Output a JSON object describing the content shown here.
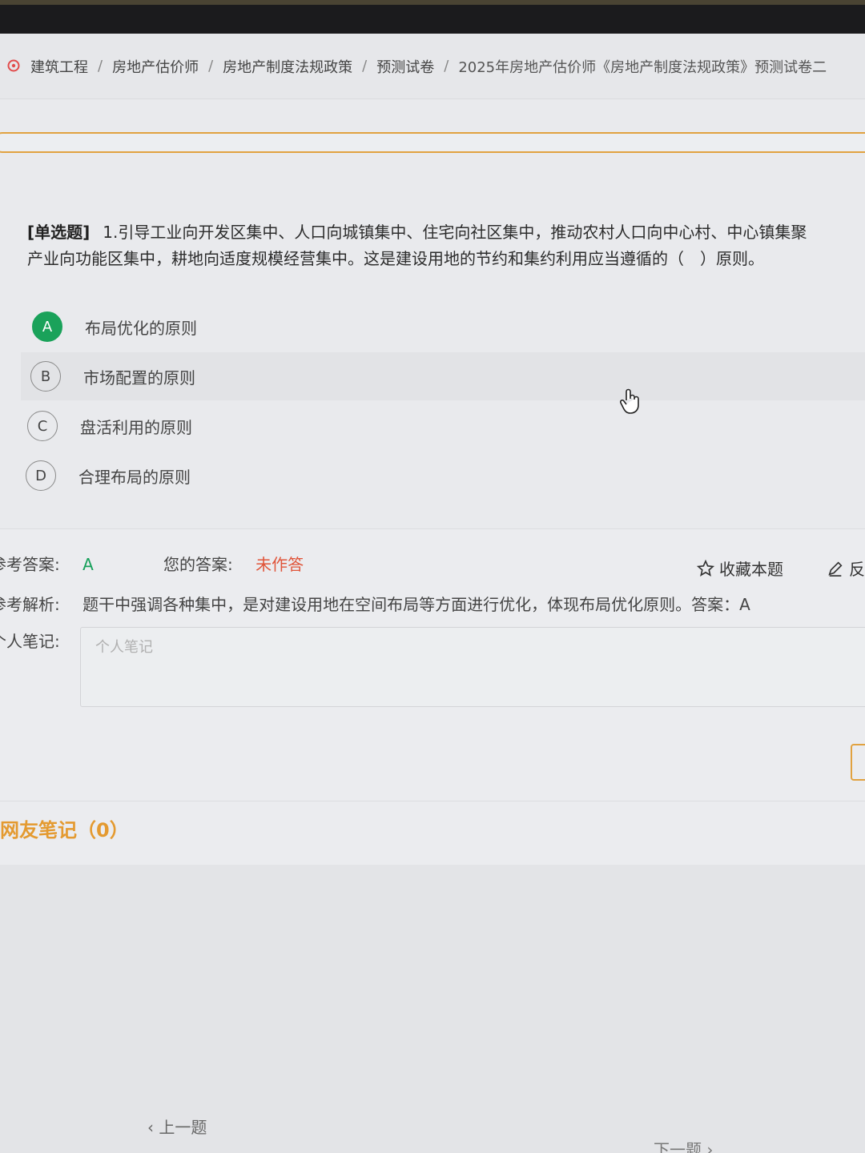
{
  "breadcrumb": {
    "items": [
      "建筑工程",
      "房地产估价师",
      "房地产制度法规政策",
      "预测试卷",
      "2025年房地产估价师《房地产制度法规政策》预测试卷二"
    ],
    "separator": "/"
  },
  "question": {
    "type_label": "[单选题]",
    "text": "1.引导工业向开发区集中、人口向城镇集中、住宅向社区集中，推动农村人口向中心村、中心镇集聚",
    "text_line2": "产业向功能区集中，耕地向适度规模经营集中。这是建设用地的节约和集约利用应当遵循的（　）原则。",
    "options": [
      {
        "letter": "A",
        "text": "布局优化的原则",
        "correct": true
      },
      {
        "letter": "B",
        "text": "市场配置的原则",
        "correct": false
      },
      {
        "letter": "C",
        "text": "盘活利用的原则",
        "correct": false
      },
      {
        "letter": "D",
        "text": "合理布局的原则",
        "correct": false
      }
    ]
  },
  "answer": {
    "ref_label": "参考答案:",
    "ref_value": "A",
    "your_label": "您的答案:",
    "your_value": "未作答",
    "favorite_label": "收藏本题",
    "feedback_label": "反",
    "analysis_label": "参考解析:",
    "analysis_text": "题干中强调各种集中，是对建设用地在空间布局等方面进行优化，体现布局优化原则。答案：A",
    "note_label": "个人笔记:",
    "note_placeholder": "个人笔记"
  },
  "friends_notes": {
    "title": "网友笔记（0）"
  },
  "nav": {
    "prev": "上一题",
    "next": "下一题"
  },
  "colors": {
    "correct": "#1aa25a",
    "accent": "#e1a240",
    "warning": "#e0553a"
  }
}
